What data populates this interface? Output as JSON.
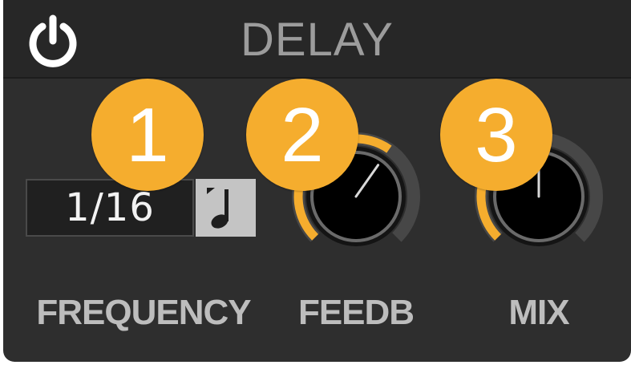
{
  "module": {
    "title": "DELAY",
    "power_icon": "power-icon",
    "accent_color": "#f5ad2e"
  },
  "callouts": [
    "1",
    "2",
    "3"
  ],
  "frequency": {
    "value": "1/16",
    "sync_icon": "quarter-note-icon",
    "label": "FREQUENCY"
  },
  "feedback": {
    "label": "FEEDB",
    "level": 0.63
  },
  "mix": {
    "label": "MIX",
    "level": 0.5
  }
}
